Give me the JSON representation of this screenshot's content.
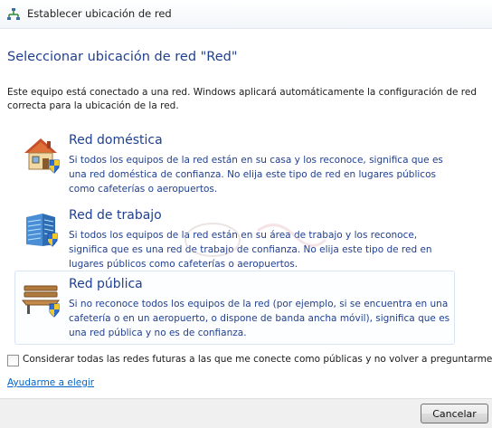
{
  "window": {
    "title": "Establecer ubicación de red"
  },
  "main": {
    "heading": "Seleccionar ubicación de red \"Red\"",
    "intro": "Este equipo está conectado a una red. Windows aplicará automáticamente la configuración de red correcta para la ubicación de la red."
  },
  "options": [
    {
      "title": "Red doméstica",
      "description": "Si todos los equipos de la red están en su casa y los reconoce, significa que es una red doméstica de confianza. No elija este tipo de red en lugares públicos como cafeterías o aeropuertos.",
      "icon": "house-icon"
    },
    {
      "title": "Red de trabajo",
      "description": "Si todos los equipos de la red están en su área de trabajo y los reconoce, significa que es una red de trabajo de confianza. No elija este tipo de red en lugares públicos como cafeterías o aeropuertos.",
      "icon": "office-building-icon"
    },
    {
      "title": "Red pública",
      "description": "Si no reconoce todos los equipos de la red (por ejemplo, si se encuentra en una cafetería o en un aeropuerto, o dispone de banda ancha móvil), significa que es una red pública y no es de confianza.",
      "icon": "park-bench-icon"
    }
  ],
  "checkbox": {
    "label": "Considerar todas las redes futuras a las que me conecte como públicas y no volver a preguntarme.",
    "checked": false
  },
  "help_link": "Ayudarme a elegir",
  "footer": {
    "cancel_label": "Cancelar"
  },
  "colors": {
    "heading": "#1f3f8f",
    "link": "#0066cc",
    "footer_bg": "#f0f0f0"
  }
}
